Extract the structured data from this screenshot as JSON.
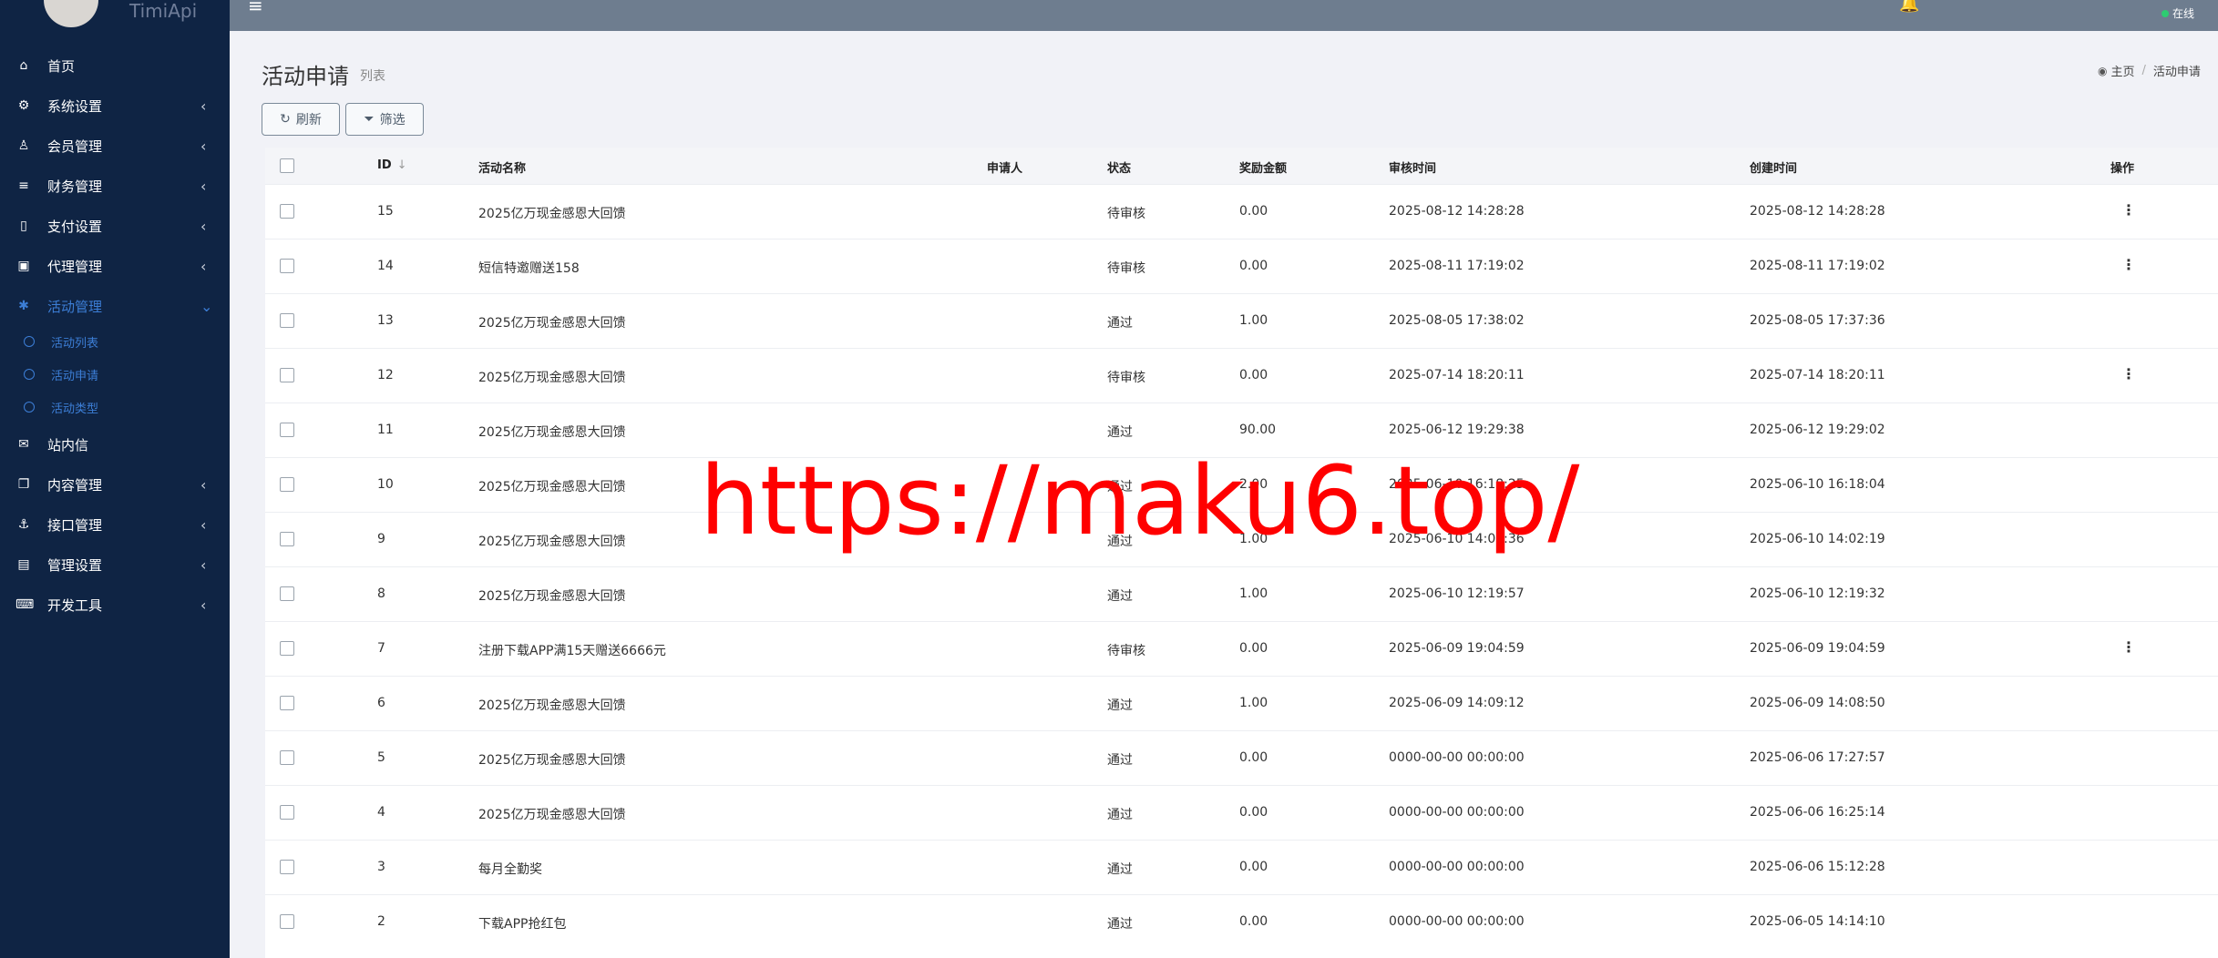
{
  "brand": {
    "name": "TimiApi"
  },
  "topbar": {
    "menu_icon": "≡",
    "status_text": "在线"
  },
  "sidebar": {
    "items": [
      {
        "label": "首页",
        "icon": "home-icon",
        "glyph": "⌂",
        "arrow": ""
      },
      {
        "label": "系统设置",
        "icon": "cogs-icon",
        "glyph": "⚙",
        "arrow": "‹"
      },
      {
        "label": "会员管理",
        "icon": "user-icon",
        "glyph": "♙",
        "arrow": "‹"
      },
      {
        "label": "财务管理",
        "icon": "database-icon",
        "glyph": "≡",
        "arrow": "‹"
      },
      {
        "label": "支付设置",
        "icon": "bookmark-icon",
        "glyph": "▯",
        "arrow": "‹"
      },
      {
        "label": "代理管理",
        "icon": "contact-icon",
        "glyph": "▣",
        "arrow": "‹"
      },
      {
        "label": "活动管理",
        "icon": "yelp-icon",
        "glyph": "✱",
        "arrow": "⌄"
      },
      {
        "label": "站内信",
        "icon": "envelope-icon",
        "glyph": "✉",
        "arrow": ""
      },
      {
        "label": "内容管理",
        "icon": "copy-icon",
        "glyph": "❐",
        "arrow": "‹"
      },
      {
        "label": "接口管理",
        "icon": "anchor-icon",
        "glyph": "⚓",
        "arrow": "‹"
      },
      {
        "label": "管理设置",
        "icon": "id-card-icon",
        "glyph": "▤",
        "arrow": "‹"
      },
      {
        "label": "开发工具",
        "icon": "keyboard-icon",
        "glyph": "⌨",
        "arrow": "‹"
      }
    ],
    "subitems": [
      {
        "label": "活动列表"
      },
      {
        "label": "活动申请"
      },
      {
        "label": "活动类型"
      }
    ]
  },
  "header": {
    "title": "活动申请",
    "subtitle": "列表"
  },
  "breadcrumb": {
    "home": "主页",
    "current": "活动申请"
  },
  "toolbar": {
    "refresh_label": "刷新",
    "filter_label": "筛选"
  },
  "table": {
    "headers": {
      "id": "ID",
      "name": "活动名称",
      "applicant": "申请人",
      "status": "状态",
      "amount": "奖励金额",
      "review_time": "审核时间",
      "create_time": "创建时间",
      "action": "操作"
    },
    "rows": [
      {
        "id": "15",
        "name": "2025亿万现金感恩大回馈",
        "applicant": "",
        "status": "待审核",
        "amount": "0.00",
        "review_time": "2025-08-12 14:28:28",
        "create_time": "2025-08-12 14:28:28",
        "action": "⋮"
      },
      {
        "id": "14",
        "name": "短信特邀赠送158",
        "applicant": "",
        "status": "待审核",
        "amount": "0.00",
        "review_time": "2025-08-11 17:19:02",
        "create_time": "2025-08-11 17:19:02",
        "action": "⋮"
      },
      {
        "id": "13",
        "name": "2025亿万现金感恩大回馈",
        "applicant": "",
        "status": "通过",
        "amount": "1.00",
        "review_time": "2025-08-05 17:38:02",
        "create_time": "2025-08-05 17:37:36",
        "action": ""
      },
      {
        "id": "12",
        "name": "2025亿万现金感恩大回馈",
        "applicant": "",
        "status": "待审核",
        "amount": "0.00",
        "review_time": "2025-07-14 18:20:11",
        "create_time": "2025-07-14 18:20:11",
        "action": "⋮"
      },
      {
        "id": "11",
        "name": "2025亿万现金感恩大回馈",
        "applicant": "",
        "status": "通过",
        "amount": "90.00",
        "review_time": "2025-06-12 19:29:38",
        "create_time": "2025-06-12 19:29:02",
        "action": ""
      },
      {
        "id": "10",
        "name": "2025亿万现金感恩大回馈",
        "applicant": "",
        "status": "通过",
        "amount": "2.00",
        "review_time": "2025-06-10 16:18:25",
        "create_time": "2025-06-10 16:18:04",
        "action": ""
      },
      {
        "id": "9",
        "name": "2025亿万现金感恩大回馈",
        "applicant": "",
        "status": "通过",
        "amount": "1.00",
        "review_time": "2025-06-10 14:02:36",
        "create_time": "2025-06-10 14:02:19",
        "action": ""
      },
      {
        "id": "8",
        "name": "2025亿万现金感恩大回馈",
        "applicant": "",
        "status": "通过",
        "amount": "1.00",
        "review_time": "2025-06-10 12:19:57",
        "create_time": "2025-06-10 12:19:32",
        "action": ""
      },
      {
        "id": "7",
        "name": "注册下载APP满15天赠送6666元",
        "applicant": "",
        "status": "待审核",
        "amount": "0.00",
        "review_time": "2025-06-09 19:04:59",
        "create_time": "2025-06-09 19:04:59",
        "action": "⋮"
      },
      {
        "id": "6",
        "name": "2025亿万现金感恩大回馈",
        "applicant": "",
        "status": "通过",
        "amount": "1.00",
        "review_time": "2025-06-09 14:09:12",
        "create_time": "2025-06-09 14:08:50",
        "action": ""
      },
      {
        "id": "5",
        "name": "2025亿万现金感恩大回馈",
        "applicant": "",
        "status": "通过",
        "amount": "0.00",
        "review_time": "0000-00-00 00:00:00",
        "create_time": "2025-06-06 17:27:57",
        "action": ""
      },
      {
        "id": "4",
        "name": "2025亿万现金感恩大回馈",
        "applicant": "",
        "status": "通过",
        "amount": "0.00",
        "review_time": "0000-00-00 00:00:00",
        "create_time": "2025-06-06 16:25:14",
        "action": ""
      },
      {
        "id": "3",
        "name": "每月全勤奖",
        "applicant": "",
        "status": "通过",
        "amount": "0.00",
        "review_time": "0000-00-00 00:00:00",
        "create_time": "2025-06-06 15:12:28",
        "action": ""
      },
      {
        "id": "2",
        "name": "下载APP抢红包",
        "applicant": "",
        "status": "通过",
        "amount": "0.00",
        "review_time": "0000-00-00 00:00:00",
        "create_time": "2025-06-05 14:14:10",
        "action": ""
      }
    ]
  },
  "watermark": {
    "text": "https://maku6.top/"
  },
  "colors": {
    "sidebar_bg": "#0f2444",
    "accent": "#3c7ed6",
    "topbar_bg": "#6e7d8f",
    "online": "#2ecc71",
    "watermark": "#ff0000"
  }
}
